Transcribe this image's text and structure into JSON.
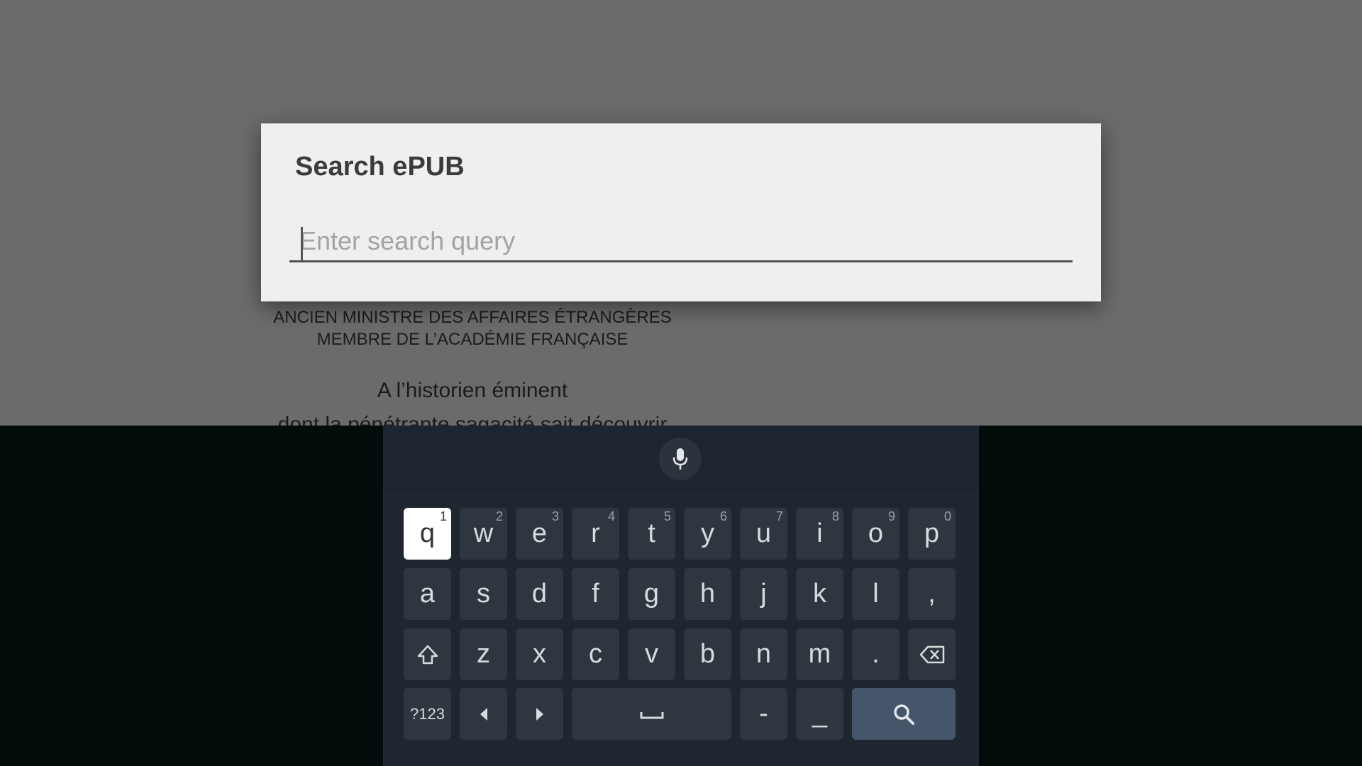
{
  "reader": {
    "line1": "ANCIEN MINISTRE DES AFFAIRES ÉTRANGÈRES",
    "line2": "MEMBRE DE L’ACADÉMIE FRANÇAISE",
    "line3": "A l’historien éminent",
    "line4": "dont la pénétrante sagacité sait découvrir"
  },
  "dialog": {
    "title": "Search ePUB",
    "placeholder": "Enter search query",
    "value": ""
  },
  "keyboard": {
    "row1": [
      {
        "label": "q",
        "hint": "1"
      },
      {
        "label": "w",
        "hint": "2"
      },
      {
        "label": "e",
        "hint": "3"
      },
      {
        "label": "r",
        "hint": "4"
      },
      {
        "label": "t",
        "hint": "5"
      },
      {
        "label": "y",
        "hint": "6"
      },
      {
        "label": "u",
        "hint": "7"
      },
      {
        "label": "i",
        "hint": "8"
      },
      {
        "label": "o",
        "hint": "9"
      },
      {
        "label": "p",
        "hint": "0"
      }
    ],
    "row2": [
      "a",
      "s",
      "d",
      "f",
      "g",
      "h",
      "j",
      "k",
      "l",
      ","
    ],
    "row3": [
      "z",
      "x",
      "c",
      "v",
      "b",
      "n",
      "m",
      "."
    ],
    "symbols_label": "?123",
    "dash_label": "-",
    "underscore_label": "_",
    "focused_key": "q",
    "icons": {
      "mic": "mic-icon",
      "shift": "shift-icon",
      "backspace": "backspace-icon",
      "left": "arrow-left-icon",
      "right": "arrow-right-icon",
      "space": "space-icon",
      "search": "search-icon"
    }
  }
}
